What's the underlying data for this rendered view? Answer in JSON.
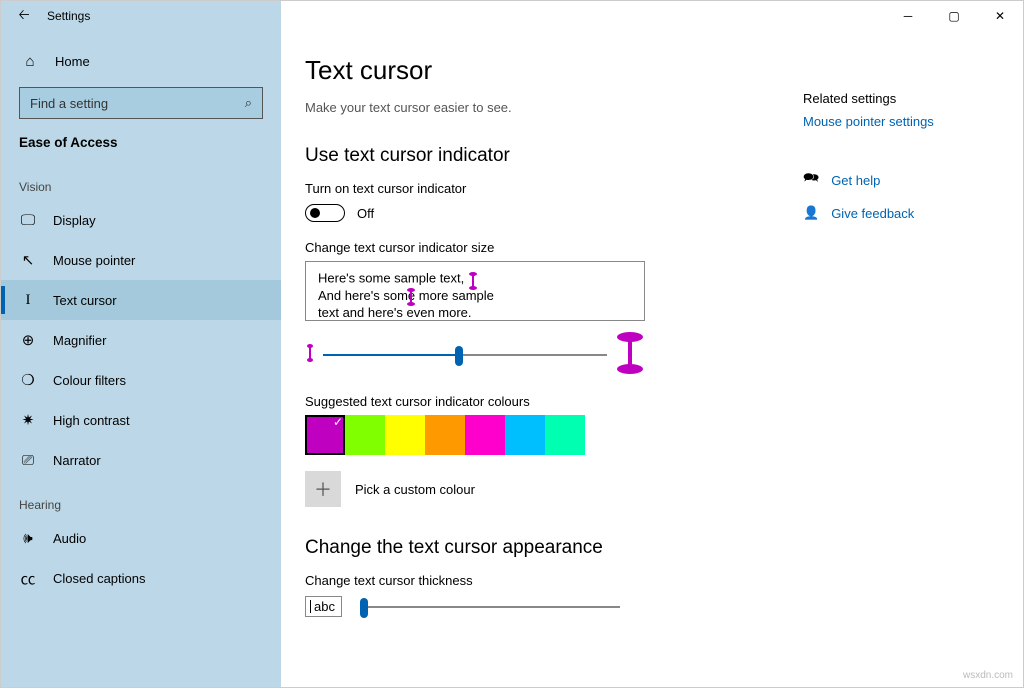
{
  "window": {
    "title": "Settings"
  },
  "sidebar": {
    "home": "Home",
    "search_placeholder": "Find a setting",
    "section": "Ease of Access",
    "group_vision": "Vision",
    "group_hearing": "Hearing",
    "items": {
      "display": "Display",
      "mouse": "Mouse pointer",
      "textcursor": "Text cursor",
      "magnifier": "Magnifier",
      "colourfilters": "Colour filters",
      "highcontrast": "High contrast",
      "narrator": "Narrator",
      "audio": "Audio",
      "closedcaptions": "Closed captions"
    }
  },
  "page": {
    "title": "Text cursor",
    "desc": "Make your text cursor easier to see.",
    "h_indicator": "Use text cursor indicator",
    "toggle_label": "Turn on text cursor indicator",
    "toggle_state": "Off",
    "size_label": "Change text cursor indicator size",
    "preview_l1": "Here's some sample text,",
    "preview_l2": "And here's some more sample",
    "preview_l3": "text and here's even more.",
    "colours_label": "Suggested text cursor indicator colours",
    "custom_label": "Pick a custom colour",
    "h_appearance": "Change the text cursor appearance",
    "thickness_label": "Change text cursor thickness",
    "abc": "abc"
  },
  "colours": [
    "#c000c0",
    "#80ff00",
    "#ffff00",
    "#ff9900",
    "#ff00cc",
    "#00bfff",
    "#00ffb0"
  ],
  "right": {
    "related": "Related settings",
    "mouse_settings": "Mouse pointer settings",
    "help": "Get help",
    "feedback": "Give feedback"
  },
  "watermark": "wsxdn.com"
}
